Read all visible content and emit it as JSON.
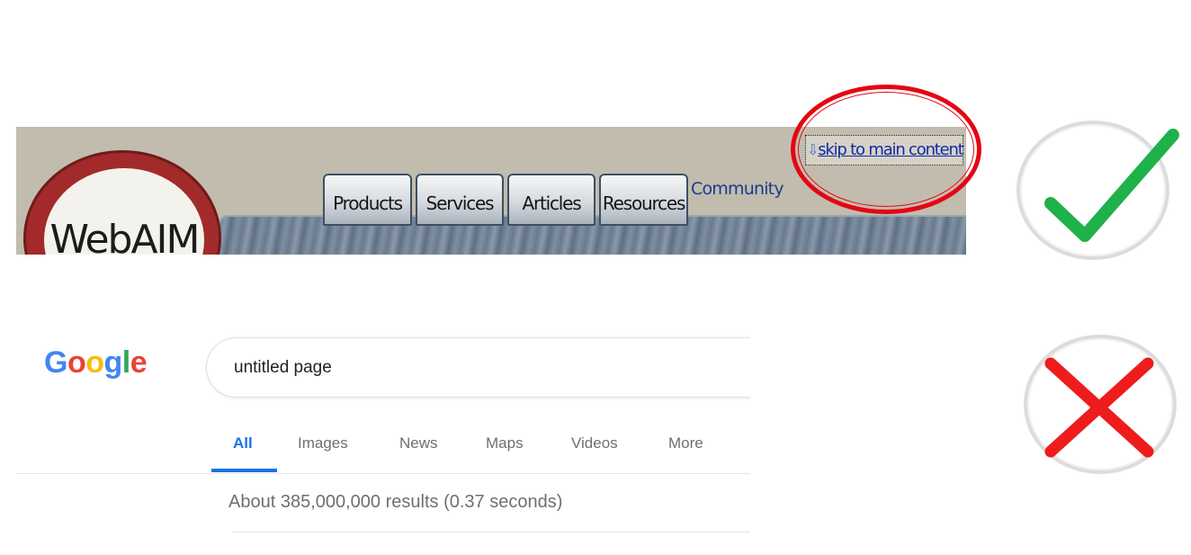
{
  "webaim": {
    "logo_text": "WebAIM",
    "nav_tabs": [
      "Products",
      "Services",
      "Articles",
      "Resources"
    ],
    "community_label": "Community",
    "skip_link": "skip to main content"
  },
  "google": {
    "logo_letters": [
      "G",
      "o",
      "o",
      "g",
      "l",
      "e"
    ],
    "logo_colors": [
      "#4285F4",
      "#EA4335",
      "#FBBC05",
      "#4285F4",
      "#34A853",
      "#EA4335"
    ],
    "search_value": "untitled page",
    "tabs": [
      "All",
      "Images",
      "News",
      "Maps",
      "Videos",
      "More"
    ],
    "active_tab": "All",
    "result_stats": "About 385,000,000 results (0.37 seconds)"
  },
  "verdicts": {
    "good": {
      "icon": "checkmark-icon",
      "color": "#1fb14a"
    },
    "bad": {
      "icon": "cross-icon",
      "color": "#ee1c1c"
    }
  },
  "highlight_color": "#e30613"
}
